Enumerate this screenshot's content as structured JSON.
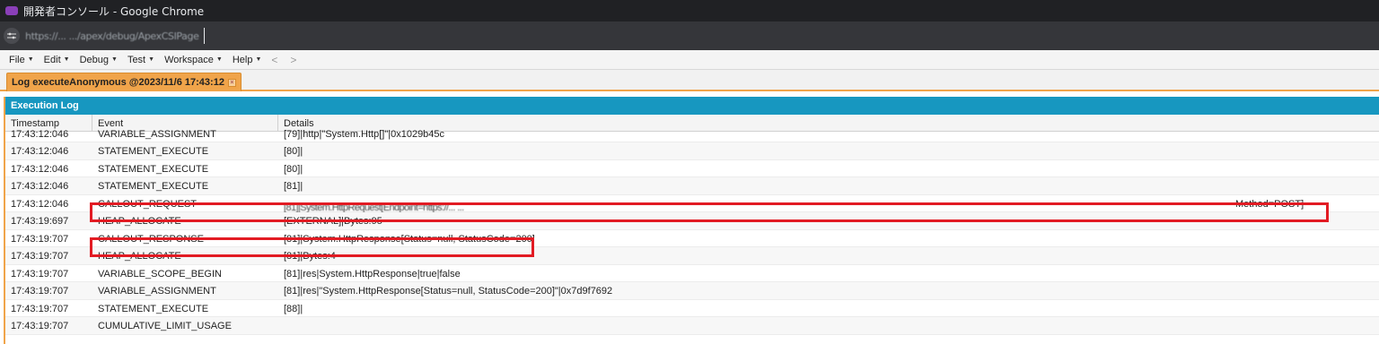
{
  "window": {
    "title": "開発者コンソール - Google Chrome"
  },
  "address_bar": {
    "url": "https://...  .../apex/debug/ApexCSIPage"
  },
  "menu": {
    "items": [
      "File",
      "Edit",
      "Debug",
      "Test",
      "Workspace",
      "Help"
    ],
    "back_arrow": "<",
    "forward_arrow": ">"
  },
  "tab": {
    "label": "Log executeAnonymous @2023/11/6 17:43:12",
    "close": "×"
  },
  "panel": {
    "title": "Execution Log",
    "columns": [
      "Timestamp",
      "Event",
      "Details"
    ]
  },
  "rows": [
    {
      "timestamp": "17:43:12:046",
      "event": "VARIABLE_ASSIGNMENT",
      "details": "[79]|http|\"System.Http[]\"|0x1029b45c"
    },
    {
      "timestamp": "17:43:12:046",
      "event": "STATEMENT_EXECUTE",
      "details": "[80]|"
    },
    {
      "timestamp": "17:43:12:046",
      "event": "STATEMENT_EXECUTE",
      "details": "[80]|"
    },
    {
      "timestamp": "17:43:12:046",
      "event": "STATEMENT_EXECUTE",
      "details": "[81]|"
    },
    {
      "timestamp": "17:43:12:046",
      "event": "CALLOUT_REQUEST",
      "details": "[81]|System.HttpRequest[Endpoint=https://... ...",
      "details_tail": "Method=POST]"
    },
    {
      "timestamp": "17:43:19:697",
      "event": "HEAP_ALLOCATE",
      "details": "[EXTERNAL]|Bytes:95"
    },
    {
      "timestamp": "17:43:19:707",
      "event": "CALLOUT_RESPONSE",
      "details": "[81]|System.HttpResponse[Status=null, StatusCode=200]"
    },
    {
      "timestamp": "17:43:19:707",
      "event": "HEAP_ALLOCATE",
      "details": "[81]|Bytes:4"
    },
    {
      "timestamp": "17:43:19:707",
      "event": "VARIABLE_SCOPE_BEGIN",
      "details": "[81]|res|System.HttpResponse|true|false"
    },
    {
      "timestamp": "17:43:19:707",
      "event": "VARIABLE_ASSIGNMENT",
      "details": "[81]|res|\"System.HttpResponse[Status=null, StatusCode=200]\"|0x7d9f7692"
    },
    {
      "timestamp": "17:43:19:707",
      "event": "STATEMENT_EXECUTE",
      "details": "[88]|"
    },
    {
      "timestamp": "17:43:19:707",
      "event": "CUMULATIVE_LIMIT_USAGE",
      "details": ""
    }
  ],
  "colors": {
    "accent_orange": "#f0a44a",
    "header_blue": "#1797c0",
    "highlight_red": "#e21b23"
  },
  "icons": {
    "site_info": "tune-icon",
    "app": "app-icon"
  }
}
